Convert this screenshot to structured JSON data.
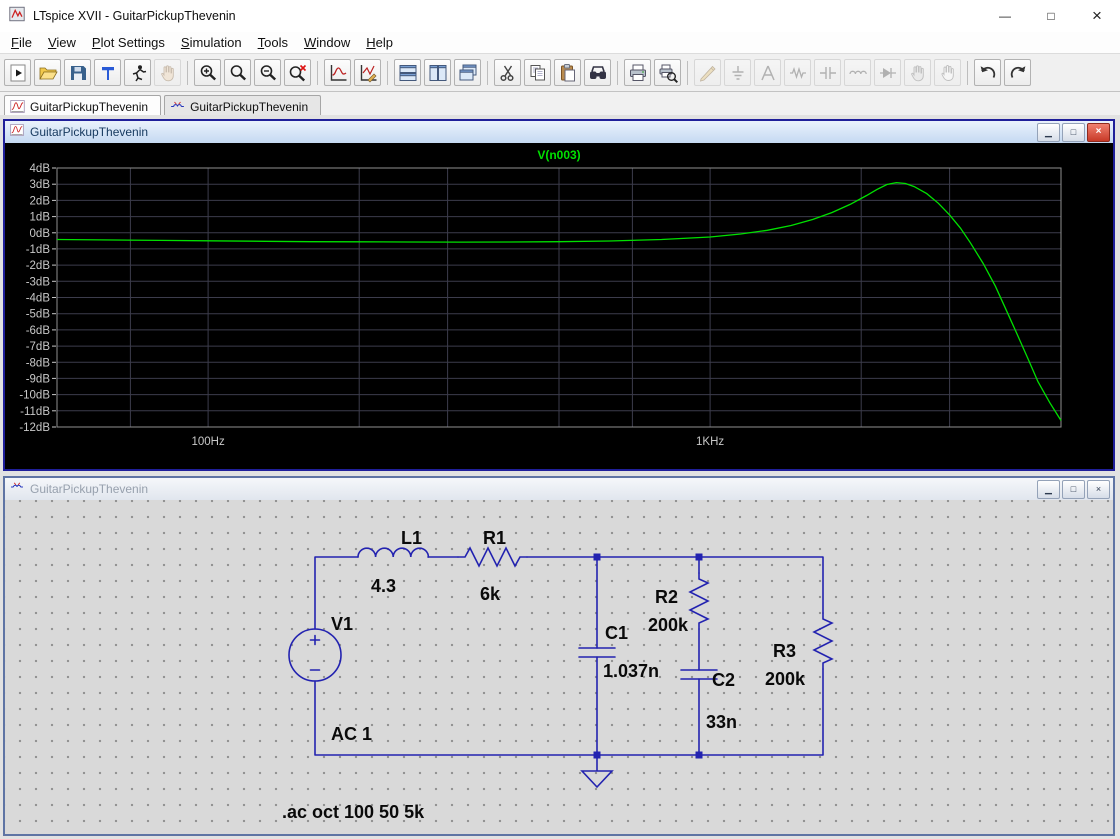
{
  "app": {
    "title": "LTspice XVII - GuitarPickupThevenin",
    "controls": [
      {
        "name": "minimize-button",
        "glyph": "—"
      },
      {
        "name": "maximize-button",
        "glyph": "□"
      },
      {
        "name": "close-button",
        "glyph": "×"
      }
    ]
  },
  "menubar": [
    "File",
    "View",
    "Plot Settings",
    "Simulation",
    "Tools",
    "Window",
    "Help"
  ],
  "toolbar": [
    {
      "name": "run-button",
      "icon": "run"
    },
    {
      "name": "open-button",
      "icon": "open"
    },
    {
      "name": "save-button",
      "icon": "save"
    },
    {
      "name": "control-panel-button",
      "icon": "control-panel"
    },
    {
      "name": "run-simulation-button",
      "icon": "runner"
    },
    {
      "name": "halt-button",
      "icon": "halt",
      "enabled": false
    },
    {
      "sep": true
    },
    {
      "name": "zoom-in-button",
      "icon": "zoom-in"
    },
    {
      "name": "zoom-back-button",
      "icon": "zoom-back"
    },
    {
      "name": "zoom-out-button",
      "icon": "zoom-out"
    },
    {
      "name": "zoom-full-extents-button",
      "icon": "zoom-full"
    },
    {
      "sep": true
    },
    {
      "name": "autorange-button",
      "icon": "autorange"
    },
    {
      "name": "plot-settings-button",
      "icon": "plot-settings"
    },
    {
      "sep": true
    },
    {
      "name": "tile-horizontal-button",
      "icon": "tile-horz"
    },
    {
      "name": "tile-vertical-button",
      "icon": "tile-vert"
    },
    {
      "name": "cascade-windows-button",
      "icon": "cascade"
    },
    {
      "sep": true
    },
    {
      "name": "cut-button",
      "icon": "cut"
    },
    {
      "name": "copy-button",
      "icon": "copy"
    },
    {
      "name": "paste-button",
      "icon": "paste"
    },
    {
      "name": "find-button",
      "icon": "find"
    },
    {
      "sep": true
    },
    {
      "name": "print-button",
      "icon": "print"
    },
    {
      "name": "print-preview-button",
      "icon": "print-preview"
    },
    {
      "sep": true
    },
    {
      "name": "wire-button",
      "icon": "wire",
      "enabled": false
    },
    {
      "name": "ground-button",
      "icon": "ground",
      "enabled": false
    },
    {
      "name": "label-net-button",
      "icon": "label",
      "enabled": false
    },
    {
      "name": "resistor-button",
      "icon": "resistor",
      "enabled": false
    },
    {
      "name": "capacitor-button",
      "icon": "capacitor",
      "enabled": false
    },
    {
      "name": "inductor-button",
      "icon": "inductor",
      "enabled": false
    },
    {
      "name": "diode-button",
      "icon": "diode",
      "enabled": false
    },
    {
      "name": "move-button",
      "icon": "move",
      "enabled": false
    },
    {
      "name": "drag-button",
      "icon": "drag",
      "enabled": false
    },
    {
      "sep": true
    },
    {
      "name": "undo-button",
      "icon": "undo"
    },
    {
      "name": "redo-button",
      "icon": "redo"
    }
  ],
  "tabs": [
    {
      "name": "tab-waveform",
      "icon": "wave-doc",
      "label": "GuitarPickupThevenin",
      "active": true
    },
    {
      "name": "tab-schematic",
      "icon": "schem-doc",
      "label": "GuitarPickupThevenin",
      "active": false
    }
  ],
  "child_window_controls": [
    {
      "name": "minimize-button",
      "glyph": "▁"
    },
    {
      "name": "restore-button",
      "glyph": "□"
    },
    {
      "name": "close-button",
      "glyph": "×"
    }
  ],
  "plot_window": {
    "title": "GuitarPickupThevenin",
    "active": true
  },
  "chart_data": {
    "type": "line",
    "title": "V(n003)",
    "x_scale": "log",
    "x_range": [
      50,
      5000
    ],
    "y_range": [
      -12,
      4
    ],
    "y_unit": "dB",
    "y_tick_labels": [
      "4dB",
      "3dB",
      "2dB",
      "1dB",
      "0dB",
      "-1dB",
      "-2dB",
      "-3dB",
      "-4dB",
      "-5dB",
      "-6dB",
      "-7dB",
      "-8dB",
      "-9dB",
      "-10dB",
      "-11dB",
      "-12dB"
    ],
    "x_tick_labels": [
      {
        "f": 100,
        "label": "100Hz"
      },
      {
        "f": 1000,
        "label": "1KHz"
      }
    ],
    "x_gridlines": [
      70,
      100,
      200,
      300,
      500,
      700,
      1000,
      2000,
      3000,
      5000
    ],
    "grid": true,
    "legend_position": "top-center-title",
    "colors": {
      "background": "#000000",
      "grid": "#3c3c4c",
      "frame": "#8f8f8f",
      "labels": "#c8c8c8"
    },
    "series": [
      {
        "name": "V(n003)",
        "color": "#00e000",
        "points": [
          [
            50,
            -0.42
          ],
          [
            65,
            -0.45
          ],
          [
            80,
            -0.47
          ],
          [
            100,
            -0.5
          ],
          [
            130,
            -0.53
          ],
          [
            160,
            -0.55
          ],
          [
            200,
            -0.56
          ],
          [
            250,
            -0.57
          ],
          [
            320,
            -0.58
          ],
          [
            400,
            -0.57
          ],
          [
            500,
            -0.55
          ],
          [
            630,
            -0.51
          ],
          [
            800,
            -0.42
          ],
          [
            1000,
            -0.26
          ],
          [
            1150,
            -0.08
          ],
          [
            1300,
            0.15
          ],
          [
            1450,
            0.45
          ],
          [
            1600,
            0.82
          ],
          [
            1750,
            1.25
          ],
          [
            1900,
            1.75
          ],
          [
            2050,
            2.3
          ],
          [
            2150,
            2.68
          ],
          [
            2250,
            2.98
          ],
          [
            2350,
            3.1
          ],
          [
            2450,
            3.04
          ],
          [
            2550,
            2.85
          ],
          [
            2700,
            2.42
          ],
          [
            2850,
            1.82
          ],
          [
            3000,
            1.1
          ],
          [
            3150,
            0.3
          ],
          [
            3300,
            -0.62
          ],
          [
            3500,
            -1.9
          ],
          [
            3700,
            -3.3
          ],
          [
            3900,
            -4.85
          ],
          [
            4100,
            -6.35
          ],
          [
            4300,
            -7.8
          ],
          [
            4500,
            -9.2
          ],
          [
            4750,
            -10.5
          ],
          [
            5000,
            -11.6
          ]
        ]
      }
    ]
  },
  "schematic": {
    "title": "GuitarPickupThevenin",
    "active": false,
    "wire_color": "#2323b0",
    "V1": {
      "ref": "V1",
      "value": "AC 1"
    },
    "L1": {
      "ref": "L1",
      "value": "4.3"
    },
    "R1": {
      "ref": "R1",
      "value": "6k"
    },
    "C1": {
      "ref": "C1",
      "value": "1.037n"
    },
    "R2": {
      "ref": "R2",
      "value": "200k"
    },
    "C2": {
      "ref": "C2",
      "value": "33n"
    },
    "R3": {
      "ref": "R3",
      "value": "200k"
    },
    "directive": ".ac oct 100 50 5k"
  }
}
